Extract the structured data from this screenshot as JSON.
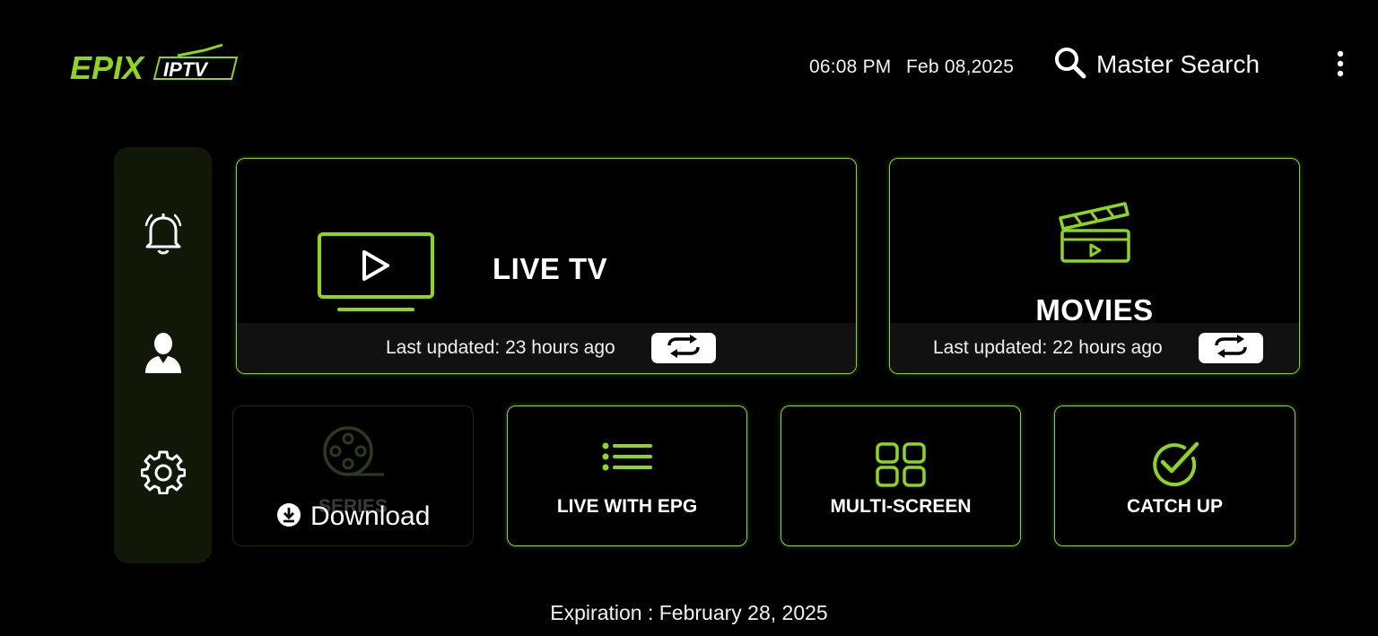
{
  "header": {
    "logo_text_left": "EPIX",
    "logo_text_right": "IPTV",
    "time": "06:08 PM",
    "date": "Feb 08,2025",
    "search_label": "Master Search",
    "search_icon": "search-icon",
    "menu_icon": "kebab-menu-icon"
  },
  "sidebar": {
    "items": [
      {
        "icon": "bell-icon",
        "name": "notifications"
      },
      {
        "icon": "user-icon",
        "name": "profile"
      },
      {
        "icon": "gear-icon",
        "name": "settings"
      }
    ]
  },
  "tiles": {
    "live_tv": {
      "title": "LIVE TV",
      "updated": "Last updated: 23 hours ago",
      "icon": "tv-play-icon"
    },
    "movies": {
      "title": "MOVIES",
      "updated": "Last updated: 22 hours ago",
      "icon": "clapperboard-icon"
    },
    "series": {
      "title": "SERIES",
      "download_label": "Download",
      "icon": "film-reel-icon"
    },
    "live_epg": {
      "title": "LIVE WITH EPG",
      "icon": "list-icon"
    },
    "multi_screen": {
      "title": "MULTI-SCREEN",
      "icon": "grid-icon"
    },
    "catch_up": {
      "title": "CATCH UP",
      "icon": "check-circle-icon"
    }
  },
  "footer": {
    "expiration": "Expiration : February 28, 2025"
  },
  "colors": {
    "accent": "#8ed61a",
    "background": "#000000",
    "sidebar": "#111808"
  }
}
